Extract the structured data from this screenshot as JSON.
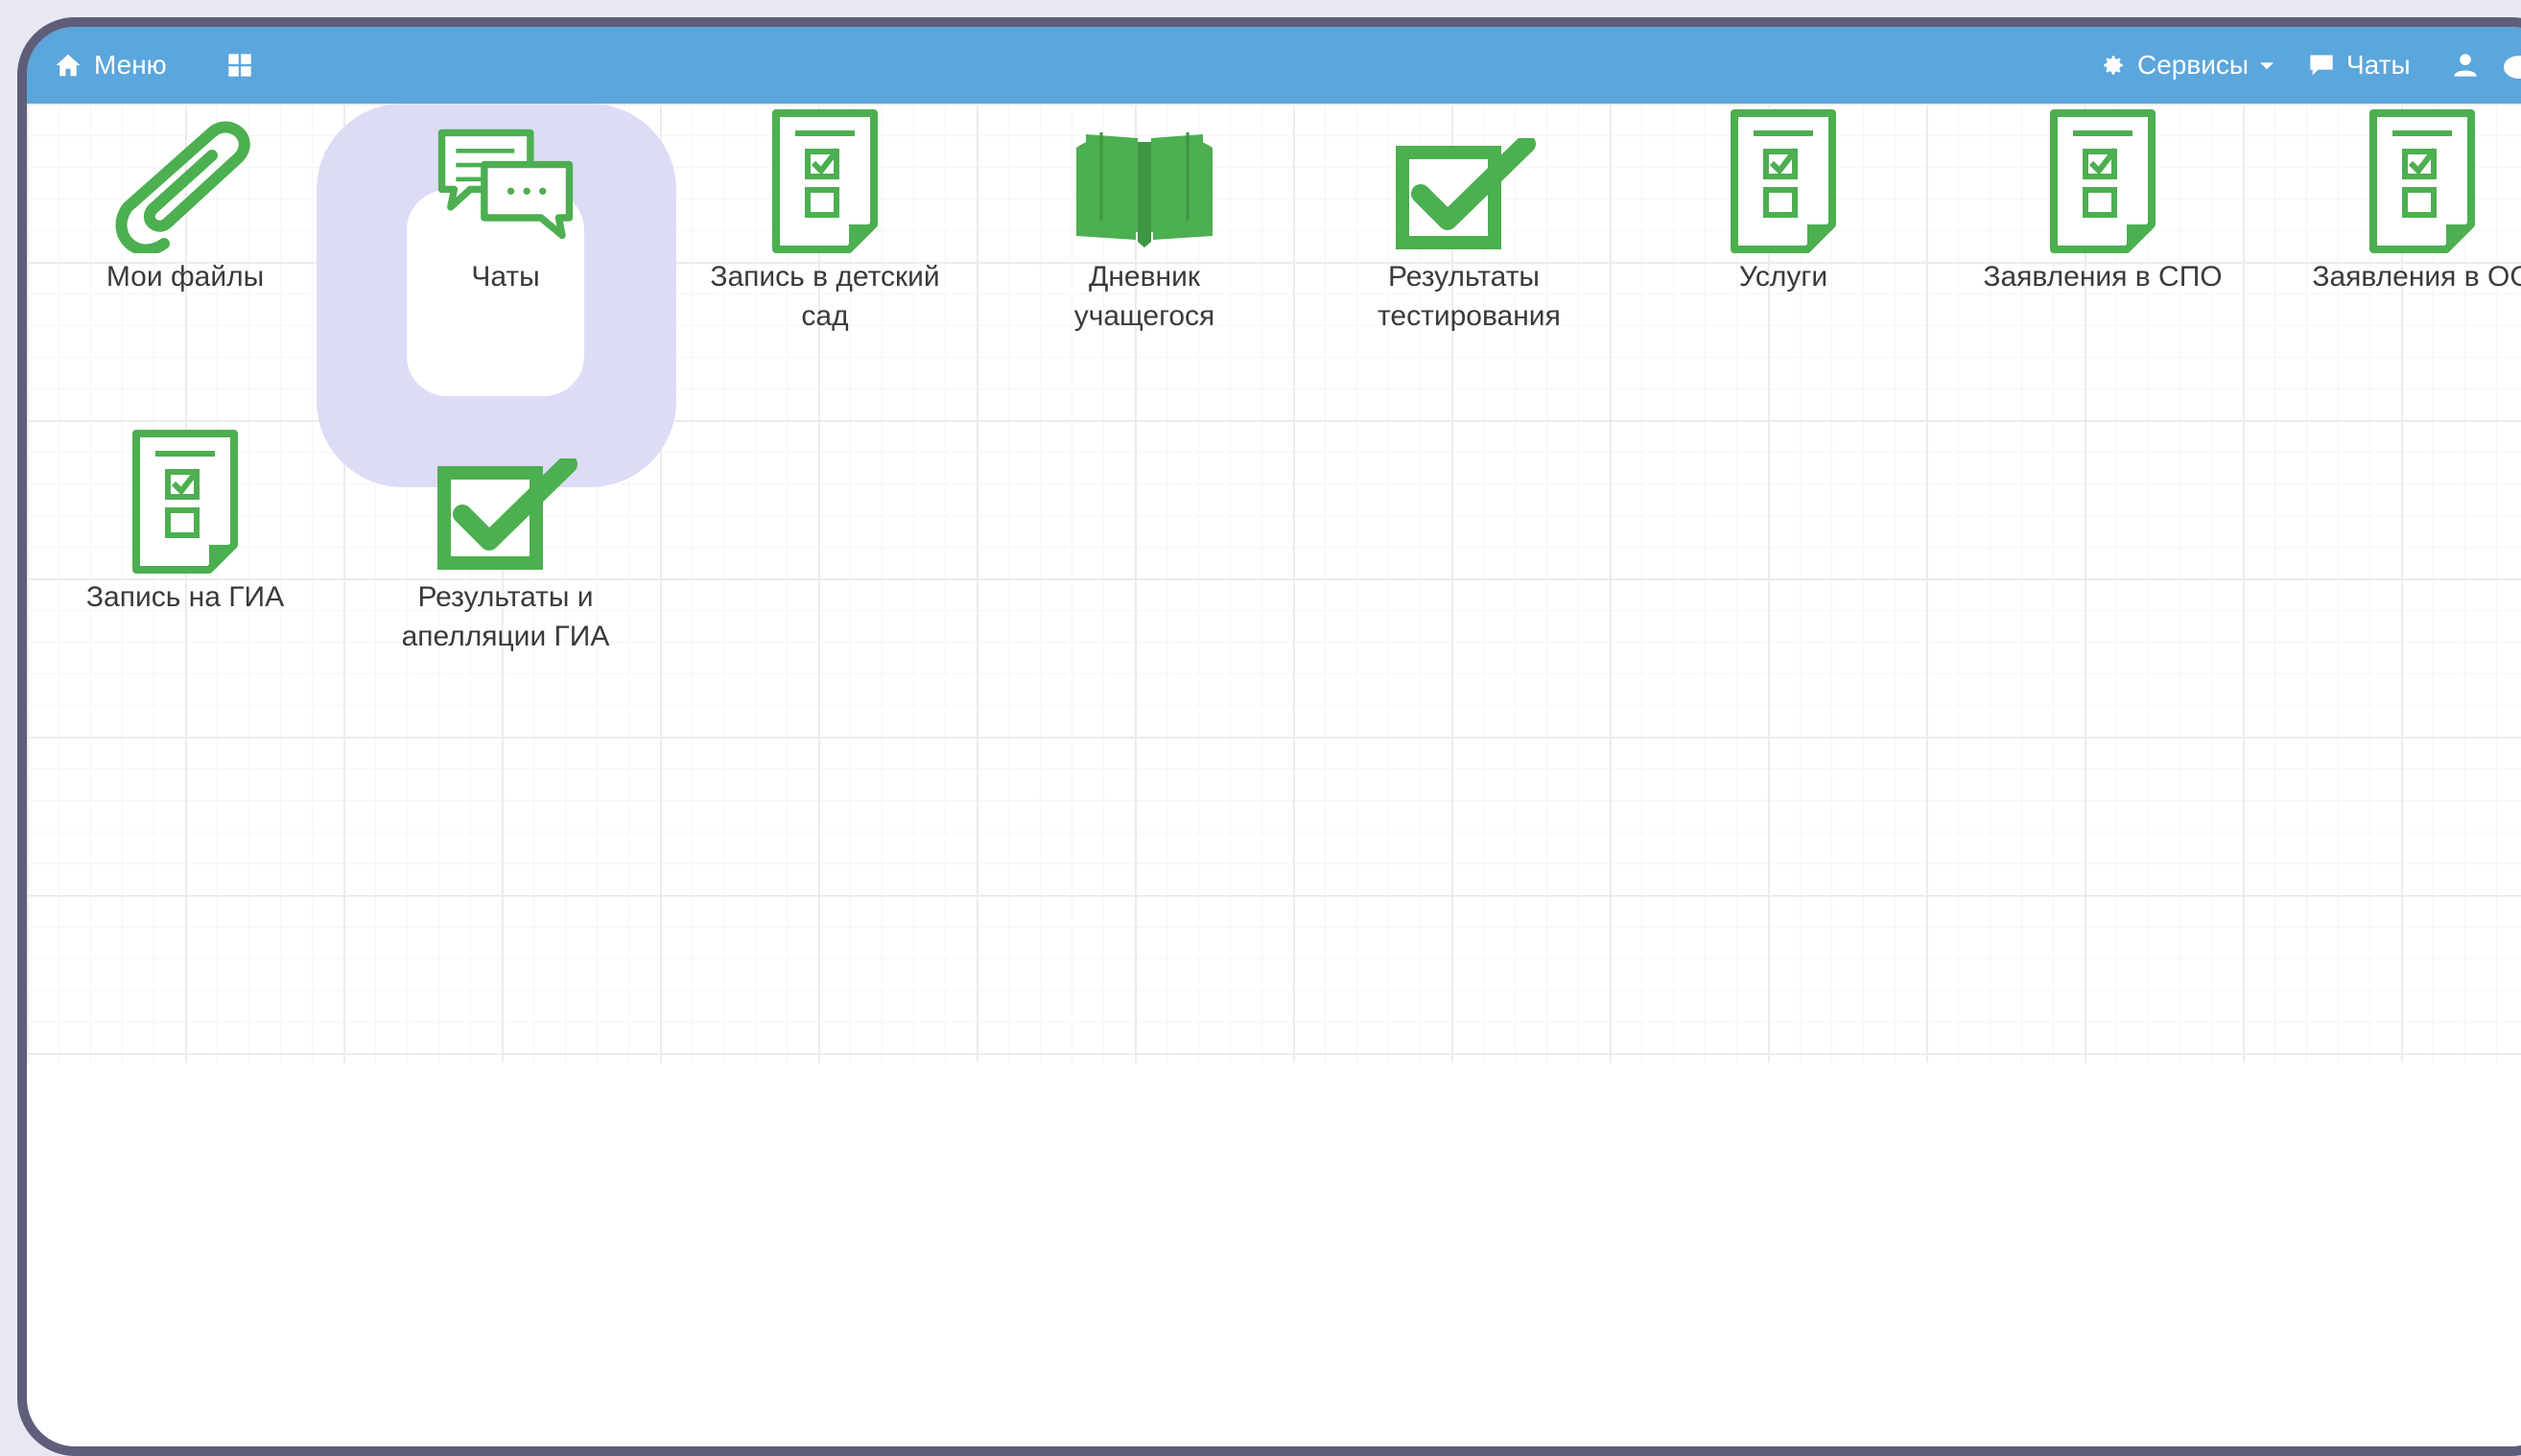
{
  "topbar": {
    "menu_label": "Меню",
    "services_label": "Сервисы",
    "chats_label": "Чаты"
  },
  "tiles": [
    {
      "label": "Мои файлы",
      "icon": "paperclip-icon"
    },
    {
      "label": "Чаты",
      "icon": "chat-bubbles-icon"
    },
    {
      "label": "Запись в детский сад",
      "icon": "document-checklist-icon"
    },
    {
      "label": "Дневник учащегося",
      "icon": "open-book-icon"
    },
    {
      "label": "Результаты тестирования",
      "icon": "checkbox-check-icon"
    },
    {
      "label": "Услуги",
      "icon": "document-checklist-icon"
    },
    {
      "label": "Заявления в СПО",
      "icon": "document-checklist-icon"
    },
    {
      "label": "Заявления в ОО",
      "icon": "document-checklist-icon"
    },
    {
      "label": "Запись на ГИА",
      "icon": "document-checklist-icon"
    },
    {
      "label": "Результаты и апелляции ГИА",
      "icon": "checkbox-check-icon"
    }
  ],
  "colors": {
    "topbar": "#5ba6dc",
    "icon_green": "#4caf50",
    "highlight": "#dcdcf6",
    "frame": "#5e5e7a"
  }
}
